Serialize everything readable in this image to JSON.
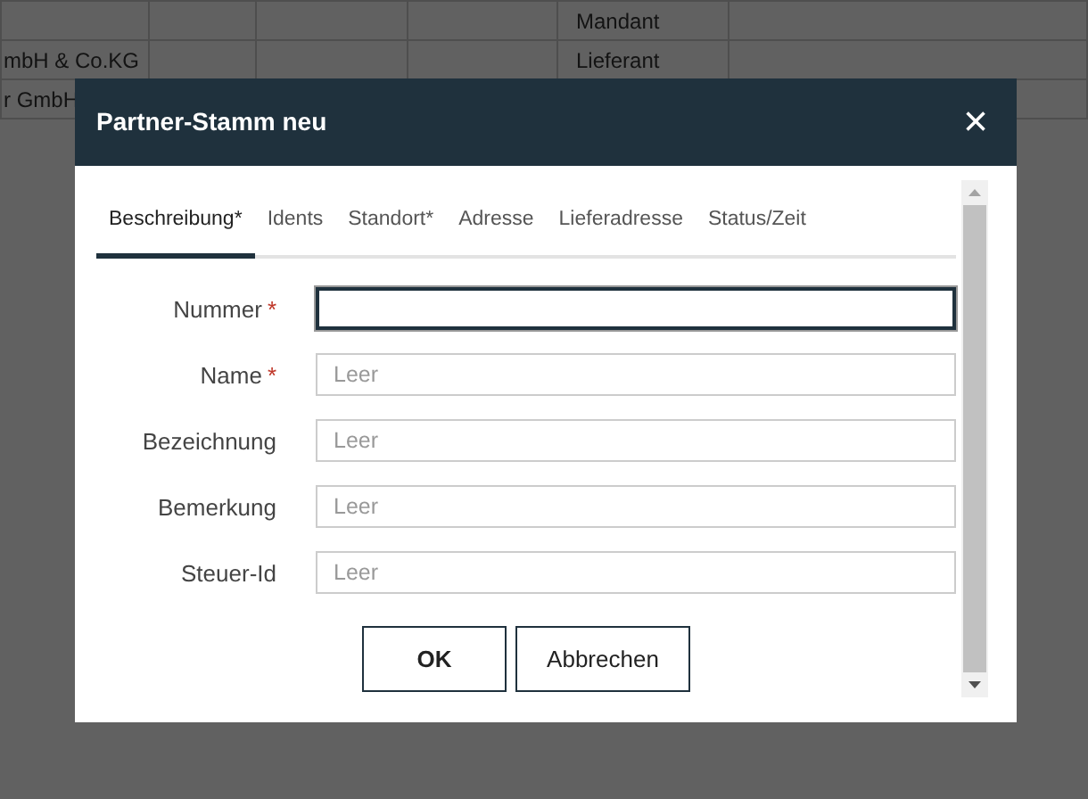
{
  "background_table": {
    "rows": [
      {
        "column_5": "Mandant"
      },
      {
        "column_1": "mbH & Co.KG",
        "column_5": "Lieferant"
      },
      {
        "column_1": "r GmbH"
      }
    ]
  },
  "dialog": {
    "title": "Partner-Stamm neu",
    "close": "×",
    "tabs": [
      {
        "label": "Beschreibung*",
        "selected": true
      },
      {
        "label": "Idents",
        "selected": false
      },
      {
        "label": "Standort*",
        "selected": false
      },
      {
        "label": "Adresse",
        "selected": false
      },
      {
        "label": "Lieferadresse",
        "selected": false
      },
      {
        "label": "Status/Zeit",
        "selected": false
      }
    ],
    "fields": [
      {
        "label": "Nummer",
        "required_mark": "*",
        "focused": true
      },
      {
        "label": "Name",
        "required_mark": "*",
        "placeholder": "Leer",
        "focused": false
      },
      {
        "label": "Bezeichnung",
        "placeholder": "Leer",
        "focused": false
      },
      {
        "label": "Bemerkung",
        "placeholder": "Leer",
        "focused": false
      },
      {
        "label": "Steuer-Id",
        "placeholder": "Leer",
        "focused": false
      }
    ],
    "buttons": [
      {
        "label": "OK",
        "kind": "primary"
      },
      {
        "label": "Abbrechen",
        "kind": "secondary"
      }
    ]
  }
}
